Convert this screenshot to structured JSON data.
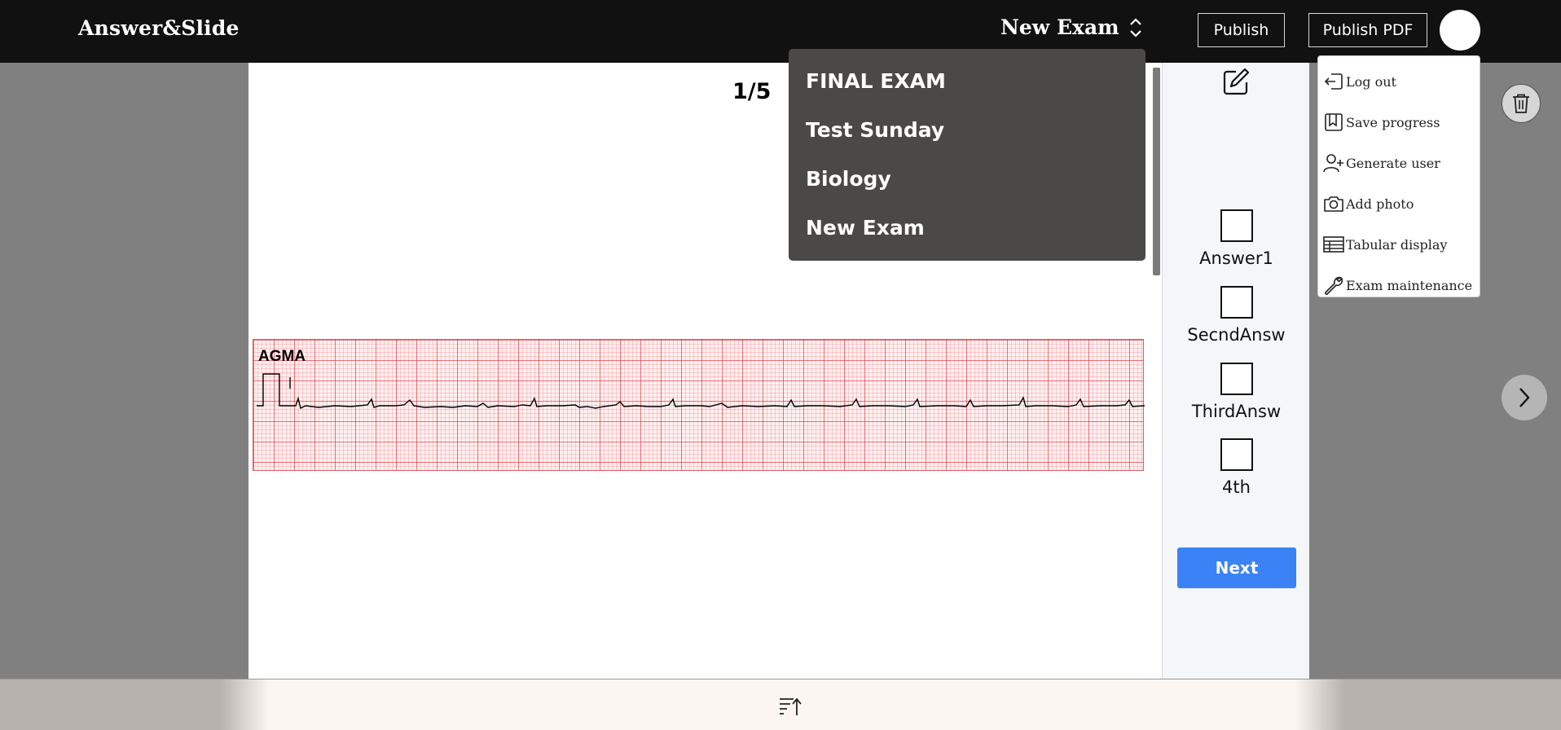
{
  "app": {
    "brand": "Answer&Slide"
  },
  "header": {
    "selected_exam": "New Exam",
    "publish_label": "Publish",
    "publish_pdf_label": "Publish PDF"
  },
  "exam_dropdown": {
    "options": [
      "FINAL EXAM",
      "Test Sunday",
      "Biology",
      "New Exam"
    ]
  },
  "user_menu": {
    "items": [
      {
        "label": "Log out",
        "icon": "log-out-icon"
      },
      {
        "label": "Save progress",
        "icon": "bookmark-icon"
      },
      {
        "label": "Generate user",
        "icon": "add-user-icon"
      },
      {
        "label": "Add photo",
        "icon": "camera-icon"
      },
      {
        "label": "Tabular display",
        "icon": "table-icon"
      },
      {
        "label": "Exam maintenance",
        "icon": "wrench-icon"
      }
    ]
  },
  "slide": {
    "page_counter": "1/5",
    "ecg_label": "AGMA"
  },
  "answers": {
    "items": [
      "Answer1",
      "SecndAnsw",
      "ThirdAnsw",
      "4th"
    ],
    "next_label": "Next"
  },
  "colors": {
    "topbar": "#111111",
    "dropdown": "#4a4948",
    "next_button": "#3b82f6",
    "ecg_grid": "#dc2832"
  }
}
